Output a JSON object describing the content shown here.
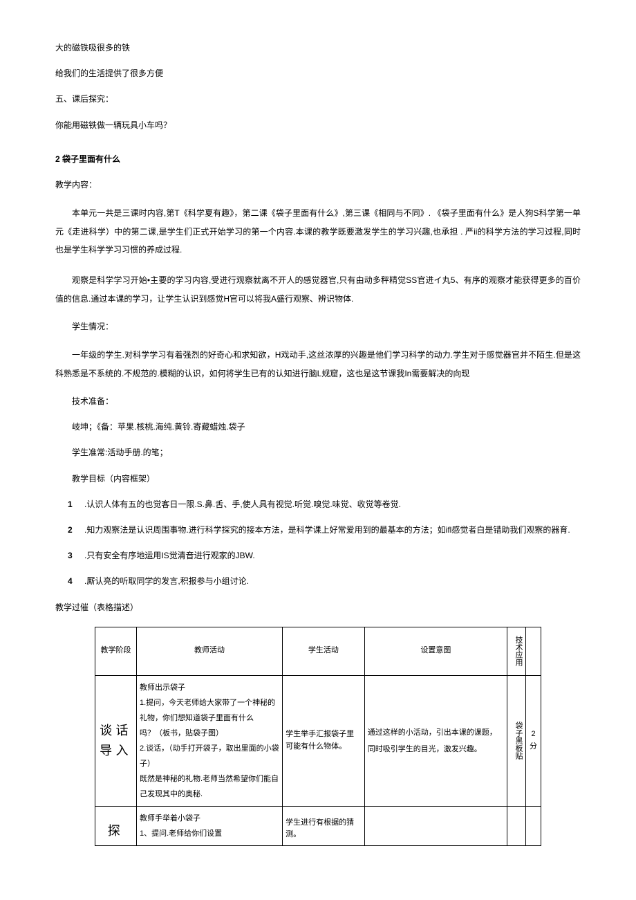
{
  "intro": {
    "line1": "大的磁铁吸很多的铁",
    "line2": "给我们的生活提供了很多方便",
    "section5": "五、课后探究：",
    "question": "你能用磁铁做一辆玩具小车吗？"
  },
  "lesson": {
    "title": "2 袋子里面有什么",
    "content_label": "教学内容：",
    "content_p1": "本单元一共是三课时内容,第T《科学夏有趣》，第二课《袋子里面有什么》,第三课《相同与不同》. 《袋子里面有什么》是人狗S科学第一单元《走进科学）中的第二课,是学生们正式开始学习的第一个内容.本课的教学既要激发学生的学习兴趣,也承担 . 严ii的科学方法的学习过程,同时也是学生科学学习习惯的养成过程.",
    "content_p2": "观察是科学学习开始•主要的学习内容,受进行观察就离不开人的感觉器官,只有由动多秤精觉SS官进イ丸5、有序的观察才能获得更多的百价值的信息.通过本课的学习，让学生认识到感觉H官可以将我A盛行观察、辨识物体.",
    "student_label": "学生情况：",
    "student_p": "一年级的学生.对科学学习有着强烈的好奇心和求知欲，H戏动手,这丝浓厚的兴趣是他们学习科学的动力.学生对于感觉器官并不陌生.但是这科熟悉是不系统的.不规范的.模糊的认识，如何将学生已有的认知进行脑L规窟，这也是这节课我In需要解决的向现",
    "tech_label": "技术准备：",
    "tech_p1": "岐坤；《备：苹果.核桃.海纯.黄铃.寄藏蜡烛.袋子",
    "tech_p2": "学生准常:活动手册.的笔；",
    "goal_label": "教学目标（内容框架）",
    "goals": [
      ".认识人体有五的也觉客日一限.S.鼻.舌、手,使人具有视觉.听觉.嗅觉.味觉、收觉等卷觉.",
      ".知力观察法是认识周围事物.进行科学探究的接本方法，是科学课上好常爱用到的最基本的方法；如ifl感觉者白是错助我们观察的器育.",
      ".只有安全有序地运用IS觉清音进行观家的JBW.",
      ".厮认亮的听取同学的发言,积报参与小组讨论."
    ],
    "process_label": "教学过催（表格描述）"
  },
  "table": {
    "headers": {
      "phase": "教学阶段",
      "teacher": "教师活动",
      "student": "学生活动",
      "intent": "设置意图",
      "tech": "技术应用"
    },
    "row1": {
      "phase": "谈话导入",
      "teacher": "教师出示袋子\n1.提问，今天老师给大家带了一个神秘的礼物，你们想知道袋子里面有什么\n吗？（板书，贴袋子图）\n2.谈话，（动手打开袋子，取出里面的小袋子）\n既然是神秘的礼物.老师当然希望你们能自己发现其中的奥秘.",
      "student": "学生举手汇报袋子里可能有什么物体。",
      "intent": "通过这样的小活动，引出本课的课题，同时吸引学生的目光，激发兴趣。",
      "tech": "袋子黑板贴",
      "time": "2分"
    },
    "row2": {
      "phase": "探",
      "teacher": "教师手举着小袋子\n1、提问.老师给你们设置",
      "student": "学生进行有根据的猜测。"
    }
  }
}
